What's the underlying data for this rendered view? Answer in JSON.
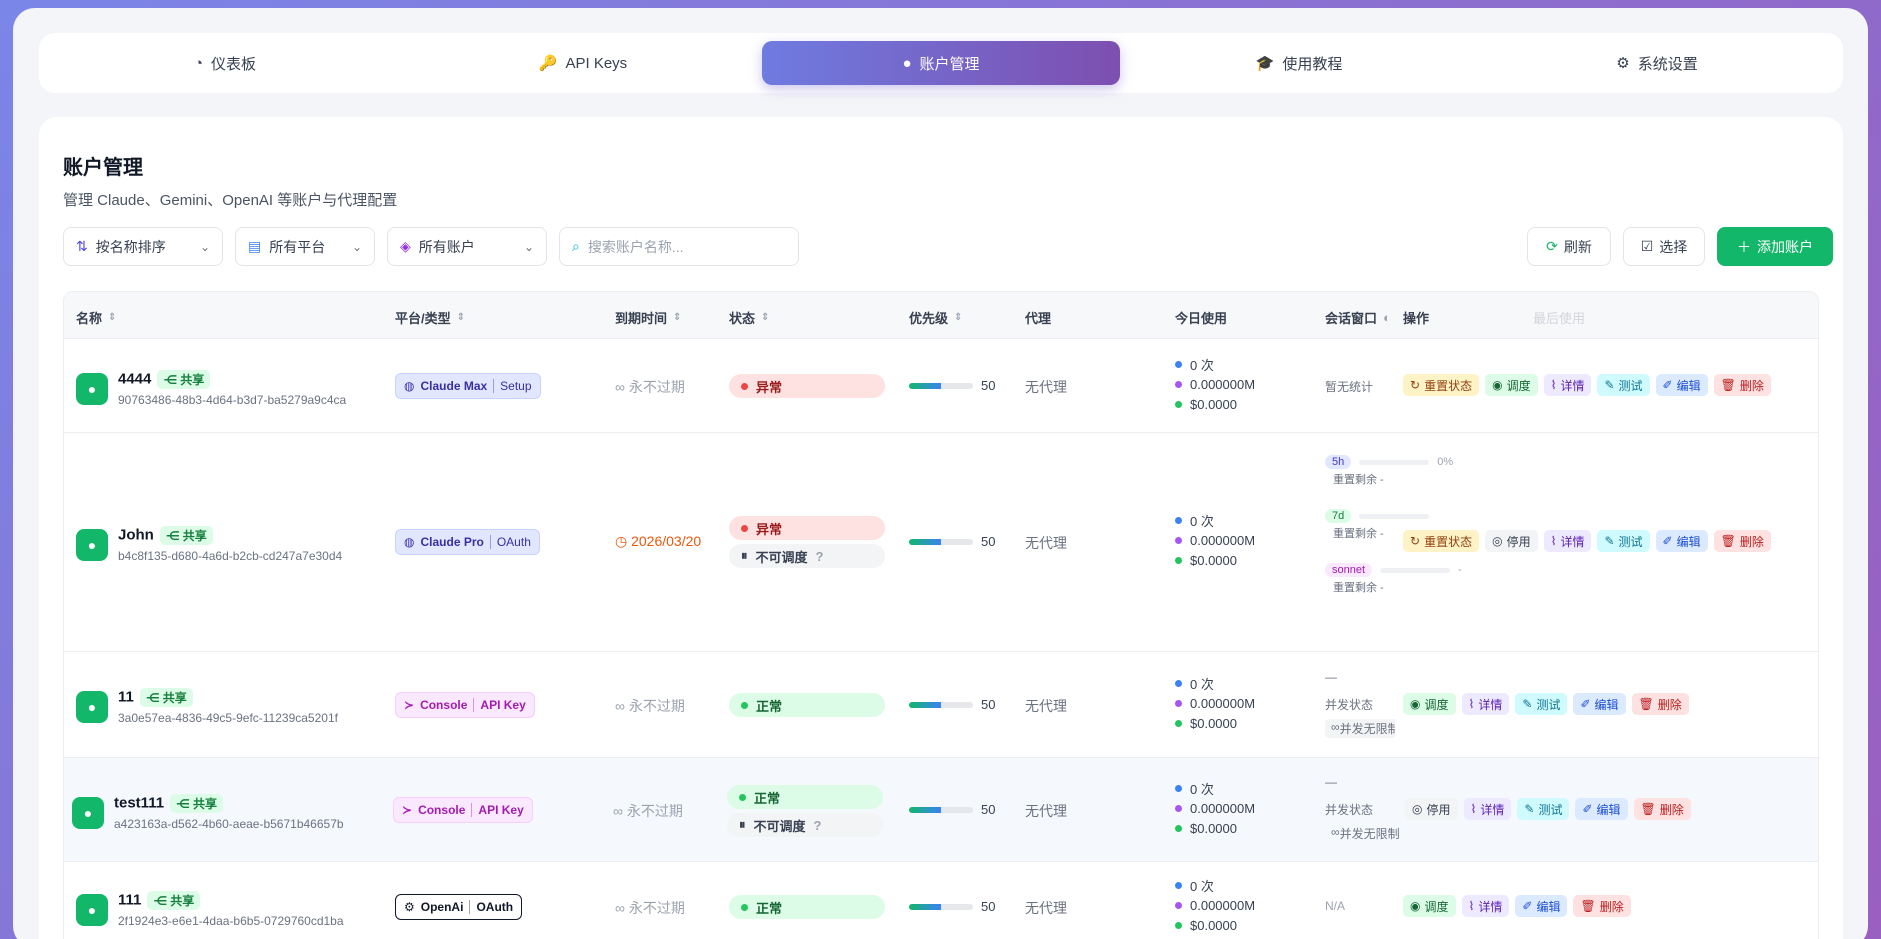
{
  "nav": {
    "tabs": [
      {
        "label": "仪表板",
        "icon": "gauge-icon"
      },
      {
        "label": "API Keys",
        "icon": "key-icon"
      },
      {
        "label": "账户管理",
        "icon": "user-circle-icon"
      },
      {
        "label": "使用教程",
        "icon": "graduation-cap-icon"
      },
      {
        "label": "系统设置",
        "icon": "gears-icon"
      }
    ]
  },
  "page": {
    "title": "账户管理",
    "subtitle": "管理 Claude、Gemini、OpenAI 等账户与代理配置"
  },
  "filters": {
    "sort": "按名称排序",
    "platform": "所有平台",
    "account": "所有账户",
    "search_placeholder": "搜索账户名称..."
  },
  "toolbar": {
    "refresh": "刷新",
    "select": "选择",
    "add": "添加账户"
  },
  "table": {
    "headers": {
      "name": "名称",
      "platform": "平台/类型",
      "expire": "到期时间",
      "status": "状态",
      "priority": "优先级",
      "proxy": "代理",
      "usage": "今日使用",
      "session": "会话窗口",
      "ops": "操作",
      "last_used": "最后使用"
    },
    "share_label": "共享",
    "rows": [
      {
        "name": "4444",
        "id": "90763486-48b3-4d64-b3d7-ba5279a9c4ca",
        "platform": "Claude Max",
        "type": "Setup",
        "expire": "永不过期",
        "status": "异常",
        "status2": "",
        "priority": "50",
        "proxy": "无代理",
        "usage_count": "0 次",
        "usage_tokens": "0.000000M",
        "usage_cost": "$0.0000",
        "session": "暂无统计",
        "ops": [
          "重置状态",
          "调度",
          "详情",
          "测试",
          "编辑",
          "删除"
        ]
      },
      {
        "name": "John",
        "id": "b4c8f135-d680-4a6d-b2cb-cd247a7e30d4",
        "platform": "Claude Pro",
        "type": "OAuth",
        "expire": "2026/03/20",
        "status": "异常",
        "status2": "不可调度",
        "priority": "50",
        "proxy": "无代理",
        "usage_count": "0 次",
        "usage_tokens": "0.000000M",
        "usage_cost": "$0.0000",
        "windows": [
          {
            "tag": "5h",
            "value": "0%",
            "reset": "重置剩余 -"
          },
          {
            "tag": "7d",
            "value": "",
            "reset": "重置剩余 -"
          },
          {
            "tag": "sonnet",
            "value": "-",
            "reset": "重置剩余 -"
          }
        ],
        "ops": [
          "重置状态",
          "停用",
          "详情",
          "测试",
          "编辑",
          "删除"
        ]
      },
      {
        "name": "11",
        "id": "3a0e57ea-4836-49c5-9efc-11239ca5201f",
        "platform": "Console",
        "type": "API Key",
        "expire": "永不过期",
        "status": "正常",
        "status2": "",
        "priority": "50",
        "proxy": "无代理",
        "usage_count": "0 次",
        "usage_tokens": "0.000000M",
        "usage_cost": "$0.0000",
        "session_dash": "—",
        "session_label": "并发状态",
        "session_value": "并发无限制",
        "ops": [
          "调度",
          "详情",
          "测试",
          "编辑",
          "删除"
        ]
      },
      {
        "name": "test111",
        "id": "a423163a-d562-4b60-aeae-b5671b46657b",
        "platform": "Console",
        "type": "API Key",
        "expire": "永不过期",
        "status": "正常",
        "status2": "不可调度",
        "priority": "50",
        "proxy": "无代理",
        "usage_count": "0 次",
        "usage_tokens": "0.000000M",
        "usage_cost": "$0.0000",
        "session_dash": "—",
        "session_label": "并发状态",
        "session_value": "并发无限制",
        "ops": [
          "停用",
          "详情",
          "测试",
          "编辑",
          "删除"
        ]
      },
      {
        "name": "111",
        "id": "2f1924e3-e6e1-4daa-b6b5-0729760cd1ba",
        "platform": "OpenAi",
        "type": "OAuth",
        "expire": "永不过期",
        "status": "正常",
        "status2": "",
        "priority": "50",
        "proxy": "无代理",
        "usage_count": "0 次",
        "usage_tokens": "0.000000M",
        "usage_cost": "$0.0000",
        "session": "N/A",
        "ops": [
          "调度",
          "详情",
          "编辑",
          "删除"
        ]
      }
    ]
  },
  "colors": {
    "accent": "#7d4fb0",
    "ok": "#12b76a",
    "error": "#ef4444"
  }
}
